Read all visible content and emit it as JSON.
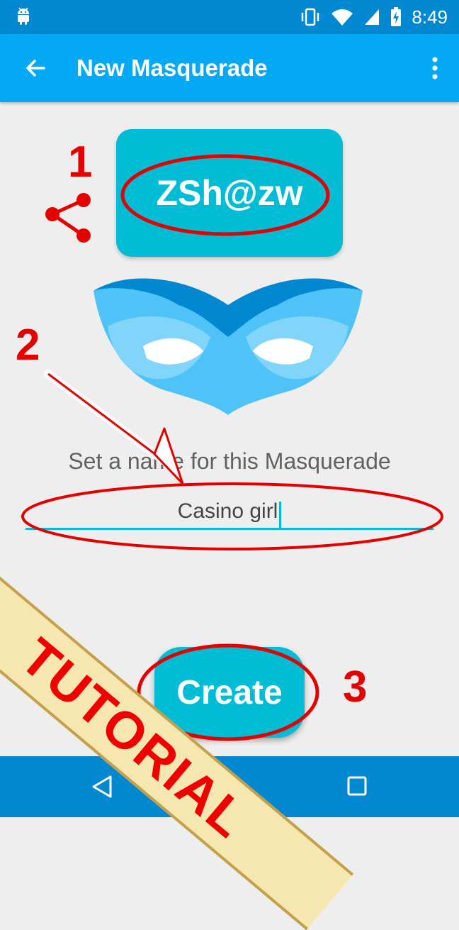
{
  "status_bar": {
    "time": "8:49"
  },
  "app_bar": {
    "title": "New Masquerade"
  },
  "code_card": {
    "code": "ZSh@zw"
  },
  "name_prompt": "Set a name for this Masquerade",
  "name_input": {
    "value": "Casino girl"
  },
  "create_button": {
    "label": "Create"
  },
  "annotations": {
    "step1": "1",
    "step2": "2",
    "step3": "3"
  },
  "tutorial_banner": "TUTORIAL",
  "colors": {
    "app_bar": "#03A9F4",
    "status_bar": "#0288D1",
    "accent": "#00BCD4",
    "annotation": "#E50000",
    "mask_light": "#4FC3F7",
    "mask_dark": "#0288D1"
  },
  "icons": [
    "android-icon",
    "vibrate-icon",
    "wifi-icon",
    "signal-icon",
    "battery-icon",
    "back-arrow-icon",
    "more-vert-icon",
    "share-icon",
    "mask-icon",
    "nav-back-icon",
    "nav-recents-icon"
  ]
}
